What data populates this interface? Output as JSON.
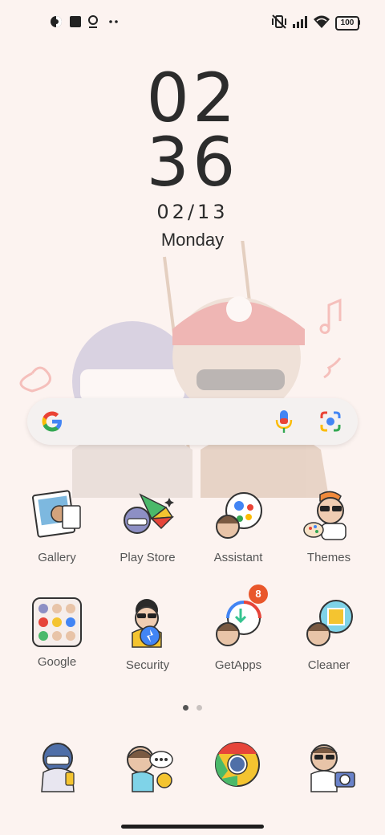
{
  "status_bar": {
    "left_icons": [
      "notification-app-icon",
      "square-app-icon",
      "location-pin-icon",
      "more-dots-icon"
    ],
    "right_icons": [
      "vibrate-off-icon",
      "signal-icon",
      "wifi-icon",
      "battery-icon"
    ],
    "battery": "100"
  },
  "clock": {
    "hours": "02",
    "minutes": "36",
    "date": "02/13",
    "weekday": "Monday"
  },
  "search": {
    "icons": [
      "google-g-icon",
      "microphone-icon",
      "lens-camera-icon"
    ]
  },
  "apps": [
    {
      "label": "Gallery"
    },
    {
      "label": "Play Store"
    },
    {
      "label": "Assistant"
    },
    {
      "label": "Themes"
    },
    {
      "label": "Google"
    },
    {
      "label": "Security"
    },
    {
      "label": "GetApps",
      "badge": "8"
    },
    {
      "label": "Cleaner"
    }
  ],
  "pager": {
    "pages": 2,
    "active": 1
  },
  "dock": [
    "phone-app",
    "messages-app",
    "chrome-app",
    "camera-app"
  ],
  "colors": {
    "background": "#fcf3f0",
    "badge": "#e9572b"
  }
}
